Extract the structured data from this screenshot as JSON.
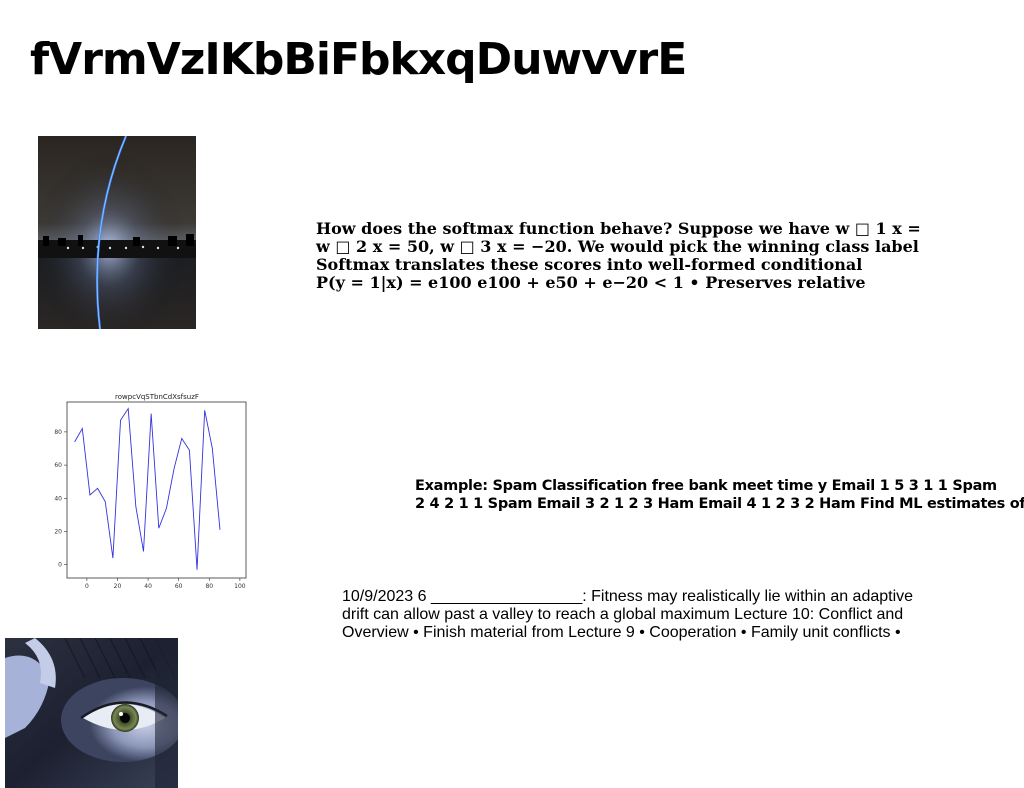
{
  "page": {
    "title": "fVrmVzIKbBiFbkxqDuwvvrE"
  },
  "images": {
    "night_lake": {
      "description_icon": "night-landscape-image"
    },
    "eye_photo": {
      "description_icon": "eye-photo-image"
    }
  },
  "text_blocks": {
    "softmax": {
      "lines": [
        "How does the softmax function behave? Suppose we have w □ 1 x =",
        "w □ 2 x = 50, w □ 3 x = −20. We would pick the winning class label",
        "Softmax translates these scores into well-formed conditional",
        "P(y = 1|x) = e100 e100 + e50 + e−20 < 1 • Preserves relative"
      ]
    },
    "spam": {
      "lines": [
        "Example: Spam Classification free bank meet time y Email 1 5 3 1 1 Spam",
        "2 4 2 1 1 Spam Email 3 2 1 2 3 Ham Email 4 1 2 3 2 Ham Find ML estimates of"
      ]
    },
    "lecture": {
      "lines": [
        "10/9/2023 6 _________________: Fitness may realistically lie within an adaptive",
        "drift can allow past a valley to reach a global maximum Lecture 10: Conflict and",
        "Overview • Finish material from Lecture 9 • Cooperation • Family unit conflicts •"
      ]
    }
  },
  "chart_data": {
    "type": "line",
    "title": "rowpcVqSTbnCdXsfsuzF",
    "xlabel": "",
    "ylabel": "",
    "x": [
      -8,
      -3,
      2,
      7,
      12,
      17,
      22,
      27,
      32,
      37,
      42,
      47,
      52,
      57,
      62,
      67,
      72,
      77,
      82,
      87,
      92,
      97
    ],
    "series": [
      {
        "values": [
          74,
          82,
          42,
          46,
          38,
          4,
          87,
          94,
          35,
          8,
          91,
          22,
          34,
          58,
          76,
          69,
          -3,
          93,
          70,
          21
        ]
      }
    ],
    "xlim": [
      -13,
      104
    ],
    "ylim": [
      -8,
      98
    ],
    "xticks": [
      0,
      20,
      40,
      60,
      80,
      100
    ],
    "yticks": [
      0,
      20,
      40,
      60,
      80
    ],
    "grid": false,
    "line_color": "#3333dd"
  }
}
